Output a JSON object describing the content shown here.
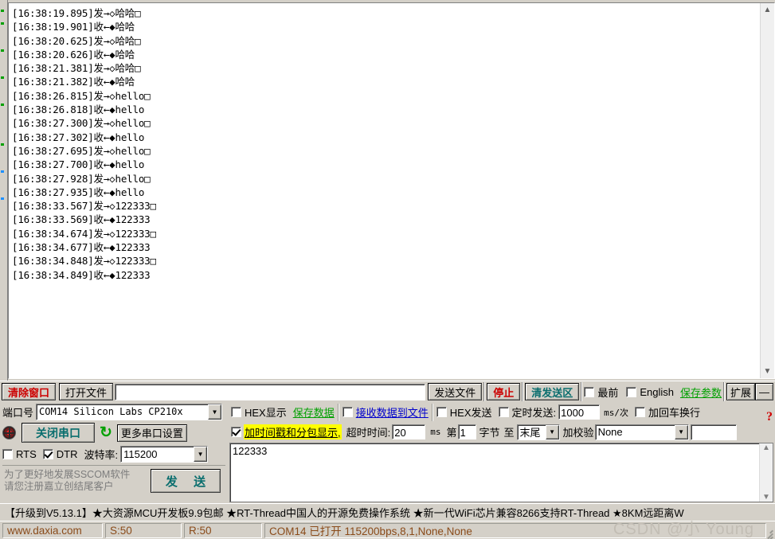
{
  "log": {
    "lines": [
      {
        "time": "[16:38:19.895]",
        "dir_cn": "发",
        "arrow": "→",
        "marker": "◇",
        "payload": "哈哈",
        "tail": "□"
      },
      {
        "time": "[16:38:19.901]",
        "dir_cn": "收",
        "arrow": "←",
        "marker": "◆",
        "payload": "哈哈",
        "tail": ""
      },
      {
        "time": "[16:38:20.625]",
        "dir_cn": "发",
        "arrow": "→",
        "marker": "◇",
        "payload": "哈哈",
        "tail": "□"
      },
      {
        "time": "[16:38:20.626]",
        "dir_cn": "收",
        "arrow": "←",
        "marker": "◆",
        "payload": "哈哈",
        "tail": ""
      },
      {
        "time": "[16:38:21.381]",
        "dir_cn": "发",
        "arrow": "→",
        "marker": "◇",
        "payload": "哈哈",
        "tail": "□"
      },
      {
        "time": "[16:38:21.382]",
        "dir_cn": "收",
        "arrow": "←",
        "marker": "◆",
        "payload": "哈哈",
        "tail": ""
      },
      {
        "time": "[16:38:26.815]",
        "dir_cn": "发",
        "arrow": "→",
        "marker": "◇",
        "payload": "hello",
        "tail": "□"
      },
      {
        "time": "[16:38:26.818]",
        "dir_cn": "收",
        "arrow": "←",
        "marker": "◆",
        "payload": "hello",
        "tail": ""
      },
      {
        "time": "[16:38:27.300]",
        "dir_cn": "发",
        "arrow": "→",
        "marker": "◇",
        "payload": "hello",
        "tail": "□"
      },
      {
        "time": "[16:38:27.302]",
        "dir_cn": "收",
        "arrow": "←",
        "marker": "◆",
        "payload": "hello",
        "tail": ""
      },
      {
        "time": "[16:38:27.695]",
        "dir_cn": "发",
        "arrow": "→",
        "marker": "◇",
        "payload": "hello",
        "tail": "□"
      },
      {
        "time": "[16:38:27.700]",
        "dir_cn": "收",
        "arrow": "←",
        "marker": "◆",
        "payload": "hello",
        "tail": ""
      },
      {
        "time": "[16:38:27.928]",
        "dir_cn": "发",
        "arrow": "→",
        "marker": "◇",
        "payload": "hello",
        "tail": "□"
      },
      {
        "time": "[16:38:27.935]",
        "dir_cn": "收",
        "arrow": "←",
        "marker": "◆",
        "payload": "hello",
        "tail": ""
      },
      {
        "time": "[16:38:33.567]",
        "dir_cn": "发",
        "arrow": "→",
        "marker": "◇",
        "payload": "122333",
        "tail": "□"
      },
      {
        "time": "[16:38:33.569]",
        "dir_cn": "收",
        "arrow": "←",
        "marker": "◆",
        "payload": "122333",
        "tail": ""
      },
      {
        "time": "[16:38:34.674]",
        "dir_cn": "发",
        "arrow": "→",
        "marker": "◇",
        "payload": "122333",
        "tail": "□"
      },
      {
        "time": "[16:38:34.677]",
        "dir_cn": "收",
        "arrow": "←",
        "marker": "◆",
        "payload": "122333",
        "tail": ""
      },
      {
        "time": "[16:38:34.848]",
        "dir_cn": "发",
        "arrow": "→",
        "marker": "◇",
        "payload": "122333",
        "tail": "□"
      },
      {
        "time": "[16:38:34.849]",
        "dir_cn": "收",
        "arrow": "←",
        "marker": "◆",
        "payload": "122333",
        "tail": ""
      }
    ]
  },
  "toolbar": {
    "clear_window": "清除窗口",
    "open_file": "打开文件",
    "file_path_value": "",
    "send_file": "发送文件",
    "stop": "停止",
    "clear_send_area": "清发送区",
    "topmost_label": "最前",
    "topmost_checked": false,
    "english_label": "English",
    "english_checked": false,
    "save_params": "保存参数",
    "extend": "扩展",
    "minimize": "—"
  },
  "port_panel": {
    "port_label": "端口号",
    "port_value": "COM14 Silicon Labs CP210x ",
    "close_port": "关闭串口",
    "refresh_icon": "refresh-icon",
    "more_settings": "更多串口设置",
    "rts_label": "RTS",
    "rts_checked": false,
    "dtr_label": "DTR",
    "dtr_checked": true,
    "baud_label": "波特率:",
    "baud_value": "115200",
    "hint_line1": "为了更好地发展SSCOM软件",
    "hint_line2": "请您注册嘉立创结尾客户",
    "send_button": "发 送"
  },
  "settings": {
    "hex_display_label": "HEX显示",
    "hex_display_checked": false,
    "save_data": "保存数据",
    "recv_to_file_label": "接收数据到文件",
    "recv_to_file_checked": false,
    "hex_send_label": "HEX发送",
    "hex_send_checked": false,
    "timed_send_label": "定时发送:",
    "timed_send_checked": false,
    "timed_send_value": "1000",
    "timed_send_unit": "ms/次",
    "add_crlf_label": "加回车换行",
    "add_crlf_checked": false,
    "timestamp_label": "加时间戳和分包显示,",
    "timestamp_checked": true,
    "timeout_label": "超时时间:",
    "timeout_value": "20",
    "timeout_unit": "ms",
    "byte_from_label": "第",
    "byte_from_value": "1",
    "byte_label": "字节",
    "byte_to_label": "至",
    "byte_to_value": "末尾",
    "checksum_label": "加校验",
    "checksum_value": "None",
    "checksum_extra_value": "",
    "help_icon": "?"
  },
  "send_area": {
    "value": "122333"
  },
  "ad_banner": {
    "text": "【升级到V5.13.1】★大资源MCU开发板9.9包邮 ★RT-Thread中国人的开源免费操作系统 ★新一代WiFi芯片兼容8266支持RT-Thread ★8KM远距离W"
  },
  "statusbar": {
    "website": "www.daxia.com",
    "sent": "S:50",
    "received": "R:50",
    "port_status": "COM14 已打开  115200bps,8,1,None,None"
  },
  "watermark": {
    "text": "CSDN @小 Young"
  },
  "colors": {
    "face": "#d4d0c8",
    "red": "#cc0000",
    "green": "#00a000",
    "teal": "#0a6e6e",
    "blue": "#0000cc",
    "highlight": "#ffff00",
    "status_text": "#8a4b1a"
  }
}
